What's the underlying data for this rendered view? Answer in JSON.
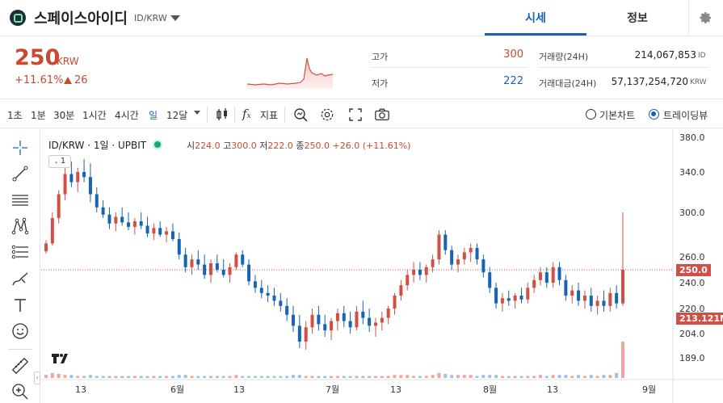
{
  "header": {
    "coin_name": "스페이스아이디",
    "coin_pair": "ID/KRW",
    "tab_quote": "시세",
    "tab_info": "정보"
  },
  "summary": {
    "price": "250",
    "price_unit": "KRW",
    "change_rate": "+11.61%",
    "change_amount": "26",
    "high_label": "고가",
    "high_value": "300",
    "low_label": "저가",
    "low_value": "222",
    "volume_label": "거래량(24H)",
    "volume_value": "214,067,853",
    "volume_unit": "ID",
    "turnover_label": "거래대금(24H)",
    "turnover_value": "57,137,254,720",
    "turnover_unit": "KRW"
  },
  "toolbar": {
    "intervals": [
      "1초",
      "1분",
      "30분",
      "1시간",
      "4시간",
      "일",
      "12달"
    ],
    "active_interval": "일",
    "indicator_label": "지표",
    "basic_chart_label": "기본차트",
    "trading_view_label": "트레이딩뷰"
  },
  "legend": {
    "symbol": "ID/KRW · 1일 · UPBIT",
    "open_label": "시",
    "open_value": "224.0",
    "high_label": "고",
    "high_value": "300.0",
    "low_label": "저",
    "low_value": "222.0",
    "close_label": "종",
    "close_value": "250.0",
    "change": "+26.0 (+11.61%)",
    "volume_button": "1"
  },
  "colors": {
    "up": "#d24f45",
    "down": "#1763b6",
    "accent": "#1763b6",
    "volume_up": "#f2a4a0",
    "volume_down": "#9ec1ec"
  },
  "price_axis": {
    "ticks": [
      "380.0",
      "340.0",
      "300.0",
      "260.0",
      "240.0",
      "220.0",
      "204.0",
      "189.0"
    ],
    "current_price_tag": "250.0",
    "volume_tag": "213.121M"
  },
  "time_axis": {
    "ticks": [
      "13",
      "6월",
      "13",
      "7월",
      "13",
      "8월",
      "13",
      "9월"
    ]
  },
  "chart_data": {
    "type": "candlestick",
    "y_ticks": [
      380,
      340,
      300,
      260,
      240,
      220,
      204,
      189
    ],
    "ohlc": [
      [
        265,
        275,
        263,
        272
      ],
      [
        272,
        300,
        270,
        295
      ],
      [
        295,
        322,
        290,
        318
      ],
      [
        318,
        345,
        312,
        338
      ],
      [
        338,
        352,
        325,
        330
      ],
      [
        330,
        345,
        320,
        340
      ],
      [
        340,
        355,
        330,
        335
      ],
      [
        335,
        350,
        310,
        318
      ],
      [
        318,
        325,
        300,
        305
      ],
      [
        305,
        312,
        295,
        298
      ],
      [
        298,
        305,
        285,
        290
      ],
      [
        290,
        300,
        283,
        296
      ],
      [
        296,
        305,
        288,
        291
      ],
      [
        291,
        300,
        284,
        287
      ],
      [
        287,
        295,
        280,
        292
      ],
      [
        292,
        300,
        285,
        288
      ],
      [
        288,
        296,
        278,
        281
      ],
      [
        281,
        290,
        275,
        286
      ],
      [
        286,
        292,
        278,
        280
      ],
      [
        280,
        287,
        273,
        283
      ],
      [
        283,
        290,
        274,
        276
      ],
      [
        276,
        282,
        258,
        262
      ],
      [
        262,
        268,
        248,
        252
      ],
      [
        252,
        262,
        246,
        258
      ],
      [
        258,
        266,
        250,
        254
      ],
      [
        254,
        262,
        243,
        246
      ],
      [
        246,
        258,
        240,
        255
      ],
      [
        255,
        262,
        248,
        250
      ],
      [
        250,
        258,
        244,
        246
      ],
      [
        246,
        255,
        240,
        252
      ],
      [
        252,
        264,
        250,
        262
      ],
      [
        262,
        266,
        252,
        254
      ],
      [
        254,
        258,
        238,
        241
      ],
      [
        241,
        246,
        232,
        236
      ],
      [
        236,
        242,
        228,
        232
      ],
      [
        232,
        238,
        225,
        230
      ],
      [
        230,
        236,
        222,
        226
      ],
      [
        226,
        232,
        218,
        222
      ],
      [
        222,
        228,
        212,
        216
      ],
      [
        216,
        222,
        205,
        209
      ],
      [
        209,
        216,
        195,
        199
      ],
      [
        199,
        212,
        194,
        208
      ],
      [
        208,
        220,
        204,
        216
      ],
      [
        216,
        222,
        206,
        210
      ],
      [
        210,
        216,
        202,
        206
      ],
      [
        206,
        214,
        200,
        212
      ],
      [
        212,
        220,
        206,
        217
      ],
      [
        217,
        222,
        208,
        212
      ],
      [
        212,
        218,
        204,
        208
      ],
      [
        208,
        222,
        206,
        218
      ],
      [
        218,
        226,
        210,
        214
      ],
      [
        214,
        220,
        205,
        209
      ],
      [
        209,
        214,
        202,
        211
      ],
      [
        211,
        218,
        206,
        214
      ],
      [
        214,
        222,
        210,
        220
      ],
      [
        220,
        232,
        216,
        230
      ],
      [
        230,
        242,
        226,
        238
      ],
      [
        238,
        250,
        234,
        246
      ],
      [
        246,
        256,
        240,
        250
      ],
      [
        250,
        256,
        242,
        246
      ],
      [
        246,
        254,
        240,
        252
      ],
      [
        252,
        262,
        248,
        258
      ],
      [
        258,
        284,
        254,
        280
      ],
      [
        280,
        284,
        262,
        266
      ],
      [
        266,
        270,
        250,
        254
      ],
      [
        254,
        262,
        248,
        258
      ],
      [
        258,
        268,
        254,
        264
      ],
      [
        264,
        272,
        256,
        268
      ],
      [
        268,
        272,
        254,
        258
      ],
      [
        258,
        262,
        244,
        248
      ],
      [
        248,
        252,
        232,
        236
      ],
      [
        236,
        240,
        220,
        224
      ],
      [
        224,
        232,
        218,
        228
      ],
      [
        228,
        234,
        222,
        226
      ],
      [
        226,
        232,
        220,
        230
      ],
      [
        230,
        236,
        224,
        227
      ],
      [
        227,
        240,
        224,
        236
      ],
      [
        236,
        246,
        232,
        242
      ],
      [
        242,
        252,
        238,
        248
      ],
      [
        248,
        252,
        236,
        240
      ],
      [
        240,
        256,
        236,
        252
      ],
      [
        252,
        256,
        238,
        242
      ],
      [
        242,
        246,
        226,
        230
      ],
      [
        230,
        238,
        224,
        234
      ],
      [
        234,
        240,
        222,
        226
      ],
      [
        226,
        234,
        220,
        230
      ],
      [
        230,
        236,
        218,
        222
      ],
      [
        222,
        230,
        216,
        226
      ],
      [
        226,
        234,
        218,
        222
      ],
      [
        222,
        236,
        218,
        232
      ],
      [
        232,
        238,
        220,
        224
      ],
      [
        224,
        300,
        222,
        250
      ]
    ],
    "volume_relative": [
      0.3,
      0.5,
      0.4,
      0.3,
      0.3,
      0.2,
      0.2,
      0.3,
      0.2,
      0.2,
      0.2,
      0.2,
      0.2,
      0.2,
      0.2,
      0.2,
      0.2,
      0.2,
      0.2,
      0.2,
      0.2,
      0.3,
      0.3,
      0.2,
      0.2,
      0.2,
      0.2,
      0.2,
      0.2,
      0.2,
      0.3,
      0.2,
      0.2,
      0.2,
      0.2,
      0.2,
      0.2,
      0.2,
      0.2,
      0.3,
      0.3,
      0.2,
      0.2,
      0.2,
      0.2,
      0.2,
      0.2,
      0.2,
      0.2,
      0.2,
      0.2,
      0.2,
      0.2,
      0.2,
      0.2,
      0.3,
      0.3,
      0.3,
      0.2,
      0.2,
      0.2,
      0.3,
      0.5,
      0.4,
      0.3,
      0.3,
      0.3,
      0.3,
      0.2,
      0.3,
      0.3,
      0.3,
      0.2,
      0.2,
      0.2,
      0.2,
      0.2,
      0.2,
      0.3,
      0.2,
      0.3,
      0.3,
      0.3,
      0.2,
      0.3,
      0.2,
      0.3,
      0.2,
      0.3,
      0.3,
      0.5,
      3.6
    ]
  }
}
